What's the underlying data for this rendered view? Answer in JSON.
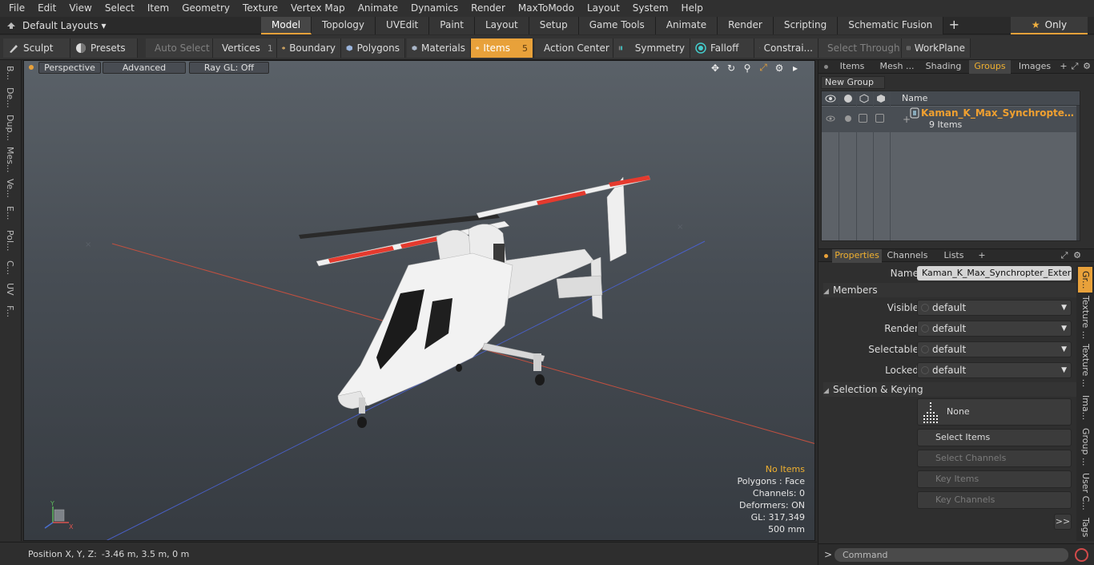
{
  "menu": [
    "File",
    "Edit",
    "View",
    "Select",
    "Item",
    "Geometry",
    "Texture",
    "Vertex Map",
    "Animate",
    "Dynamics",
    "Render",
    "MaxToModo",
    "Layout",
    "System",
    "Help"
  ],
  "layouts": {
    "label": "Default Layouts ▾"
  },
  "mode_tabs": [
    "Model",
    "Topology",
    "UVEdit",
    "Paint",
    "Layout",
    "Setup",
    "Game Tools",
    "Animate",
    "Render",
    "Scripting",
    "Schematic Fusion"
  ],
  "active_mode_tab": "Model",
  "only_label": "Only",
  "toolbar": {
    "sculpt": "Sculpt",
    "presets": "Presets",
    "auto_select": "Auto Select",
    "vertices": "Vertices",
    "vertices_count": "1",
    "boundary": "Boundary",
    "polygons": "Polygons",
    "materials": "Materials",
    "items": "Items",
    "items_count": "5",
    "action_center": "Action Center",
    "symmetry": "Symmetry",
    "falloff": "Falloff",
    "constraints": "Constrai...",
    "select_through": "Select Through",
    "workplane": "WorkPlane"
  },
  "left_strip": [
    "B...",
    "De...",
    "Dup...",
    "Mes...",
    "Ve...",
    "E...",
    "Pol...",
    "C...",
    "UV",
    "F..."
  ],
  "viewport": {
    "perspective": "Perspective",
    "advanced": "Advanced",
    "raygl": "Ray GL: Off",
    "stats": {
      "no_items": "No Items",
      "polygons": "Polygons : Face",
      "channels": "Channels: 0",
      "deformers": "Deformers: ON",
      "gl": "GL: 317,349",
      "scale": "500 mm"
    },
    "gizmo_y": "Y",
    "gizmo_x": "X"
  },
  "status": {
    "label": "Position X, Y, Z:",
    "value": "-3.46 m, 3.5 m, 0 m"
  },
  "right_tabs": [
    "Items",
    "Mesh ...",
    "Shading",
    "Groups",
    "Images"
  ],
  "active_right_tab": "Groups",
  "groups": {
    "new_group": "New Group",
    "name_col": "Name",
    "item_name": "Kaman_K_Max_Synchropter_Ex...",
    "item_sub": "9 Items"
  },
  "prop_tabs": [
    "Properties",
    "Channels",
    "Lists"
  ],
  "properties": {
    "name_label": "Name",
    "name_value": "Kaman_K_Max_Synchropter_Exterior",
    "members": "Members",
    "visible_label": "Visible",
    "visible_value": "default",
    "render_label": "Render",
    "render_value": "default",
    "selectable_label": "Selectable",
    "selectable_value": "default",
    "locked_label": "Locked",
    "locked_value": "default",
    "selection_keying": "Selection & Keying",
    "none_btn": "None",
    "select_items": "Select Items",
    "select_channels": "Select Channels",
    "key_items": "Key Items",
    "key_channels": "Key Channels",
    "more": ">>"
  },
  "vertical_tabs": [
    "Gr...",
    "Texture ...",
    "Texture ...",
    "Ima...",
    "Group ...",
    "User C...",
    "Tags"
  ],
  "command": {
    "prompt": ">",
    "placeholder": "Command"
  },
  "colors": {
    "accent": "#e8a13a",
    "group_name": "#f0a030"
  }
}
